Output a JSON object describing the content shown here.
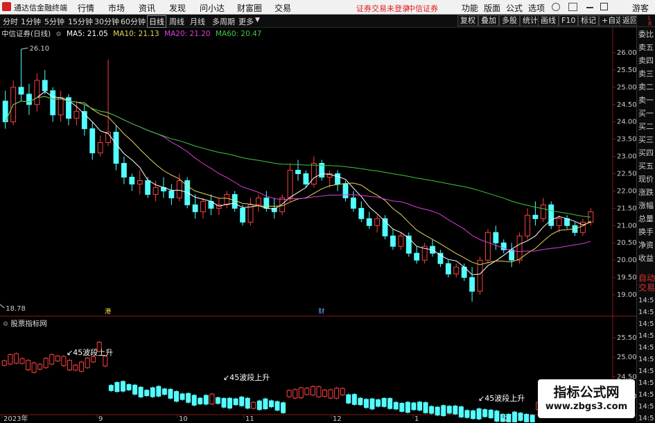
{
  "menubar": {
    "app_title": "通达信金融终端",
    "items": [
      "行情",
      "市场",
      "资讯",
      "发现",
      "问小达",
      "财富圈",
      "交易"
    ],
    "notice": "证券交易未登录",
    "broker": "中信证券",
    "right_items": [
      "功能",
      "版面",
      "公式",
      "选项"
    ],
    "user": "游客"
  },
  "toolbar": {
    "periods": [
      "分时",
      "1分钟",
      "5分钟",
      "15分钟",
      "30分钟",
      "60分钟",
      "日线",
      "周线",
      "月线",
      "多周期",
      "更多"
    ],
    "active": "日线",
    "right_buttons": [
      "复权",
      "叠加",
      "多股",
      "统计",
      "画线",
      "F10",
      "标记",
      "+自选",
      "返回"
    ]
  },
  "main_info": {
    "stock": "中信证券(日线)",
    "ma5": "MA5: 21.05",
    "ma10": "MA10: 21.13",
    "ma20": "MA20: 21.20",
    "ma60": "MA60: 20.47"
  },
  "colors": {
    "up": "#ff4040",
    "down": "#54ffff",
    "ma5": "#ffffff",
    "ma10": "#e8d65a",
    "ma20": "#e03ce0",
    "ma60": "#3fc83f"
  },
  "chart_data": [
    {
      "type": "candlestick",
      "title": "中信证券(日线)",
      "ylim": [
        18.7,
        26.4
      ],
      "y_ticks": [
        "26.00",
        "25.50",
        "25.00",
        "24.50",
        "24.00",
        "23.50",
        "23.00",
        "22.50",
        "22.00",
        "21.50",
        "21.00",
        "20.50",
        "20.00",
        "19.50",
        "19.00"
      ],
      "y_tick_values": [
        26.0,
        25.5,
        25.0,
        24.5,
        24.0,
        23.5,
        23.0,
        22.5,
        22.0,
        21.5,
        21.0,
        20.5,
        20.0,
        19.5,
        19.0
      ],
      "annotations": [
        {
          "text": "26.10",
          "value": 26.1
        },
        {
          "text": "18.78",
          "value": 18.78
        }
      ],
      "event_markers": [
        "港",
        "财"
      ],
      "ohlc": [
        [
          24.6,
          24.9,
          23.8,
          24.0
        ],
        [
          24.0,
          25.2,
          23.9,
          25.0
        ],
        [
          25.0,
          26.1,
          24.6,
          24.8
        ],
        [
          24.8,
          25.1,
          24.2,
          24.5
        ],
        [
          24.5,
          25.4,
          24.3,
          25.2
        ],
        [
          25.2,
          25.5,
          24.8,
          24.9
        ],
        [
          24.9,
          25.0,
          24.0,
          24.2
        ],
        [
          24.2,
          24.9,
          24.0,
          24.7
        ],
        [
          24.7,
          24.8,
          23.9,
          24.1
        ],
        [
          24.1,
          24.6,
          23.9,
          24.3
        ],
        [
          24.3,
          24.5,
          23.6,
          23.8
        ],
        [
          23.8,
          24.0,
          22.9,
          23.1
        ],
        [
          23.1,
          23.6,
          23.0,
          23.4
        ],
        [
          23.4,
          25.8,
          23.3,
          23.7
        ],
        [
          23.7,
          23.9,
          22.6,
          22.8
        ],
        [
          22.8,
          23.0,
          22.2,
          22.4
        ],
        [
          22.4,
          22.5,
          22.0,
          22.2
        ],
        [
          22.2,
          22.6,
          21.9,
          22.3
        ],
        [
          22.3,
          22.4,
          21.8,
          21.9
        ],
        [
          21.9,
          22.3,
          21.7,
          22.1
        ],
        [
          22.1,
          22.4,
          21.8,
          22.0
        ],
        [
          22.0,
          22.2,
          21.6,
          21.8
        ],
        [
          21.8,
          22.5,
          21.7,
          22.3
        ],
        [
          22.3,
          22.4,
          21.5,
          21.6
        ],
        [
          21.6,
          21.9,
          21.2,
          21.4
        ],
        [
          21.4,
          21.8,
          21.2,
          21.7
        ],
        [
          21.7,
          21.9,
          21.3,
          21.5
        ],
        [
          21.5,
          21.8,
          21.3,
          21.6
        ],
        [
          21.6,
          22.0,
          21.5,
          21.9
        ],
        [
          21.9,
          22.0,
          21.4,
          21.5
        ],
        [
          21.5,
          21.6,
          21.0,
          21.1
        ],
        [
          21.1,
          21.8,
          21.0,
          21.6
        ],
        [
          21.6,
          21.9,
          21.4,
          21.8
        ],
        [
          21.8,
          22.0,
          21.4,
          21.5
        ],
        [
          21.5,
          21.8,
          21.2,
          21.4
        ],
        [
          21.4,
          21.9,
          21.3,
          21.8
        ],
        [
          21.8,
          22.8,
          21.7,
          22.6
        ],
        [
          22.6,
          22.9,
          22.3,
          22.5
        ],
        [
          22.5,
          22.6,
          22.1,
          22.2
        ],
        [
          22.2,
          23.0,
          22.1,
          22.8
        ],
        [
          22.8,
          22.9,
          22.3,
          22.4
        ],
        [
          22.4,
          22.6,
          22.1,
          22.5
        ],
        [
          22.5,
          22.6,
          22.0,
          22.2
        ],
        [
          22.2,
          22.3,
          21.7,
          21.8
        ],
        [
          21.8,
          22.0,
          21.4,
          21.5
        ],
        [
          21.5,
          21.7,
          21.1,
          21.2
        ],
        [
          21.2,
          21.4,
          20.9,
          21.0
        ],
        [
          21.0,
          21.3,
          20.8,
          21.2
        ],
        [
          21.2,
          21.3,
          20.6,
          20.7
        ],
        [
          20.7,
          20.9,
          20.3,
          20.4
        ],
        [
          20.4,
          20.8,
          20.3,
          20.7
        ],
        [
          20.7,
          20.8,
          20.1,
          20.2
        ],
        [
          20.2,
          20.4,
          19.9,
          20.0
        ],
        [
          20.0,
          20.5,
          19.9,
          20.4
        ],
        [
          20.4,
          20.6,
          20.1,
          20.2
        ],
        [
          20.2,
          20.3,
          19.8,
          19.9
        ],
        [
          19.9,
          20.0,
          19.5,
          19.6
        ],
        [
          19.6,
          19.9,
          19.5,
          19.8
        ],
        [
          19.8,
          19.9,
          19.4,
          19.5
        ],
        [
          19.5,
          19.8,
          18.8,
          19.1
        ],
        [
          19.1,
          20.1,
          19.0,
          20.0
        ],
        [
          20.0,
          20.9,
          19.9,
          20.8
        ],
        [
          20.8,
          21.0,
          20.3,
          20.5
        ],
        [
          20.5,
          20.6,
          20.2,
          20.3
        ],
        [
          20.3,
          20.5,
          19.8,
          20.0
        ],
        [
          20.0,
          20.8,
          19.9,
          20.7
        ],
        [
          20.7,
          21.5,
          20.6,
          21.3
        ],
        [
          21.3,
          21.7,
          21.0,
          21.2
        ],
        [
          21.2,
          21.8,
          21.1,
          21.6
        ],
        [
          21.6,
          21.7,
          20.9,
          21.0
        ],
        [
          21.0,
          21.3,
          20.8,
          21.2
        ],
        [
          21.2,
          21.3,
          20.9,
          21.0
        ],
        [
          21.0,
          21.1,
          20.7,
          20.8
        ],
        [
          20.8,
          21.2,
          20.7,
          21.1
        ],
        [
          21.1,
          21.5,
          21.0,
          21.4
        ]
      ]
    },
    {
      "type": "candlestick",
      "title": "股票指标网",
      "ylim": [
        23.6,
        25.8
      ],
      "y_ticks": [
        "25.50",
        "25.00",
        "24.50",
        "24.00"
      ],
      "y_tick_values": [
        25.5,
        25.0,
        24.5,
        24.0
      ],
      "annotations": [
        "45波段上升",
        "45波段上升",
        "45波段上升"
      ],
      "x_ticks": [
        "2023年",
        "9",
        "10",
        "11",
        "12",
        "1",
        "2"
      ]
    }
  ],
  "right_panel": {
    "top_letters": [
      "L",
      "R",
      "L"
    ],
    "labels": [
      "委比",
      "卖五",
      "卖四",
      "卖三",
      "卖二",
      "卖一",
      "买一",
      "买二",
      "买三",
      "买四",
      "买五",
      "现价",
      "涨跌",
      "涨幅",
      "总量",
      "换手",
      "净资",
      "收益"
    ],
    "auto_trade": [
      "自动",
      "交易"
    ],
    "times": [
      "14:5",
      "14:5",
      "14:5",
      "14:5",
      "14:5",
      "14:5",
      "14:5",
      "14:5",
      "14:5",
      "14:5",
      "14:5"
    ]
  },
  "watermark": {
    "title": "指标公式网",
    "url": "www.zbgs3.com"
  }
}
